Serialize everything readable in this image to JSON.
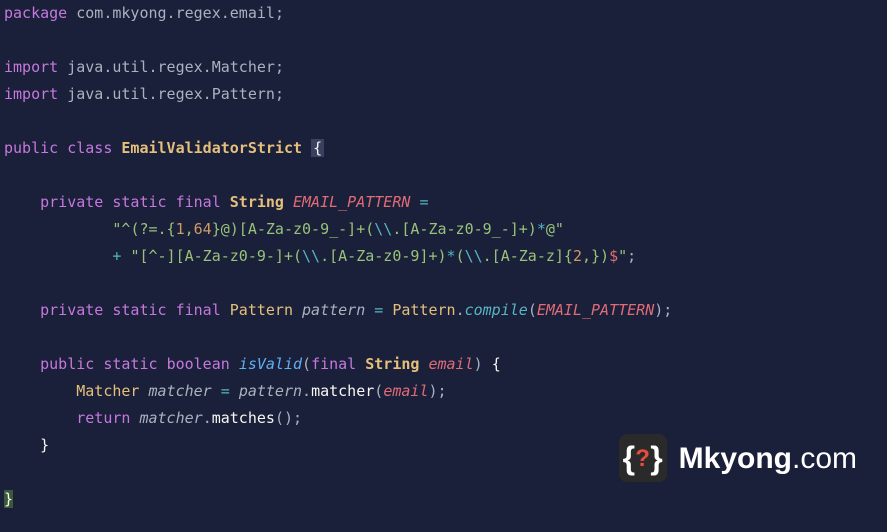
{
  "chart_data": {
    "type": "code",
    "language": "java",
    "package": "com.mkyong.regex.email",
    "imports": [
      "java.util.regex.Matcher",
      "java.util.regex.Pattern"
    ],
    "class_name": "EmailValidatorStrict",
    "email_pattern_line1": "^(?=.{1,64}@)[A-Za-z0-9_-]+(\\\\.[A-Za-z0-9_-]+)*@",
    "email_pattern_line2": "[^-][A-Za-z0-9-]+(\\\\.[A-Za-z0-9]+)*(\\\\.[A-Za-z]{2,})$",
    "method_name": "isValid",
    "method_param": "email"
  },
  "code": {
    "kw_package": "package",
    "pkg_path": "com.mkyong.regex.email",
    "kw_import": "import",
    "import1": "java.util.regex.Matcher",
    "import2": "java.util.regex.Pattern",
    "kw_public": "public",
    "kw_class": "class",
    "cls_name": "EmailValidatorStrict",
    "kw_private": "private",
    "kw_static": "static",
    "kw_final": "final",
    "type_string": "String",
    "const_name": "EMAIL_PATTERN",
    "regex1_a": "\"^",
    "regex1_b": "(?=.{",
    "regex1_c": "1",
    "regex1_d": ",",
    "regex1_e": "64",
    "regex1_f": "}@)[A-Za-z0-9_-]+(",
    "regex1_g": "\\\\",
    "regex1_h": ".[A-Za-z0-9_-]+)",
    "regex1_i": "*",
    "regex1_j": "@\"",
    "regex2_a": "\"[^-][A-Za-z0-9-]+(",
    "regex2_b": "\\\\",
    "regex2_c": ".[A-Za-z0-9]+)",
    "regex2_d": "*",
    "regex2_e": "(",
    "regex2_f": "\\\\",
    "regex2_g": ".[A-Za-z]{",
    "regex2_h": "2",
    "regex2_i": ",})",
    "regex2_j": "$",
    "regex2_k": "\"",
    "type_pattern": "Pattern",
    "var_pattern": "pattern",
    "fn_compile": "compile",
    "type_boolean": "boolean",
    "fn_isvalid": "isValid",
    "param_email": "email",
    "type_matcher": "Matcher",
    "var_matcher": "matcher",
    "fn_matcher": "matcher",
    "kw_return": "return",
    "fn_matches": "matches",
    "plus": "+",
    "eq": "=",
    "semi": ";",
    "lparen": "(",
    "rparen": ")",
    "lbrace": "{",
    "rbrace": "}",
    "dot": ".",
    "comma": ","
  },
  "watermark": {
    "brand": "Mkyong",
    "suffix": ".com",
    "q": "?"
  }
}
